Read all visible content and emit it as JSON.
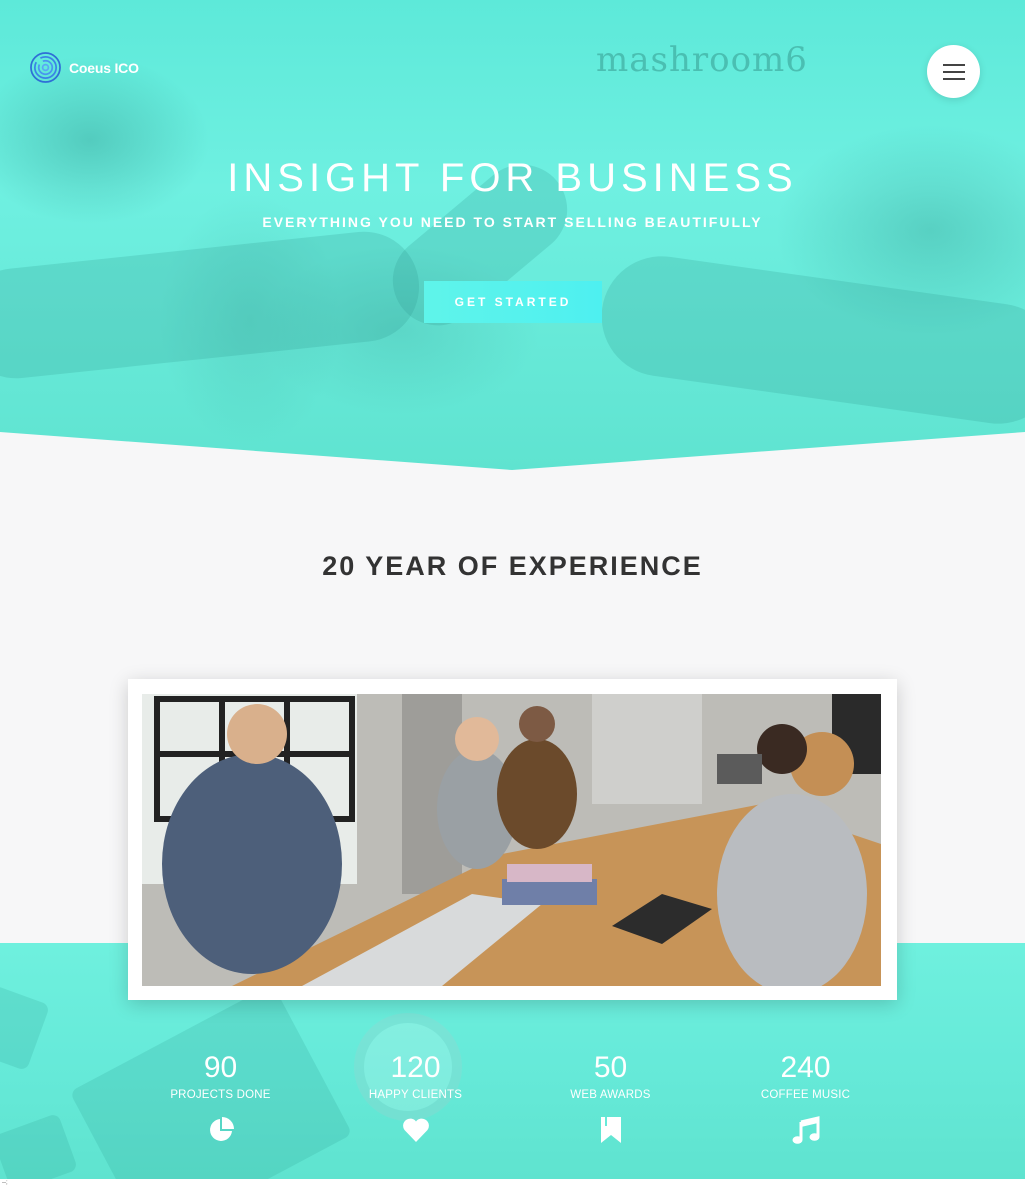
{
  "brand": {
    "name": "Coeus ICO"
  },
  "hero": {
    "watermark": "mashroom6",
    "title": "INSIGHT FOR BUSINESS",
    "subtitle": "EVERYTHING YOU NEED TO START SELLING BEAUTIFULLY",
    "cta_label": "GET STARTED"
  },
  "section": {
    "title": "20 YEAR OF EXPERIENCE"
  },
  "stats": [
    {
      "value": "90",
      "label": "PROJECTS DONE",
      "icon": "pie-chart-icon"
    },
    {
      "value": "120",
      "label": "HAPPY CLIENTS",
      "icon": "heart-icon"
    },
    {
      "value": "50",
      "label": "WEB AWARDS",
      "icon": "bookmark-icon"
    },
    {
      "value": "240",
      "label": "COFFEE MUSIC",
      "icon": "music-note-icon"
    }
  ],
  "colors": {
    "accent": "#5fe8d6",
    "cta": "#4ef0f0",
    "text_dark": "#333333"
  },
  "footer": {
    "mark": "--;"
  }
}
